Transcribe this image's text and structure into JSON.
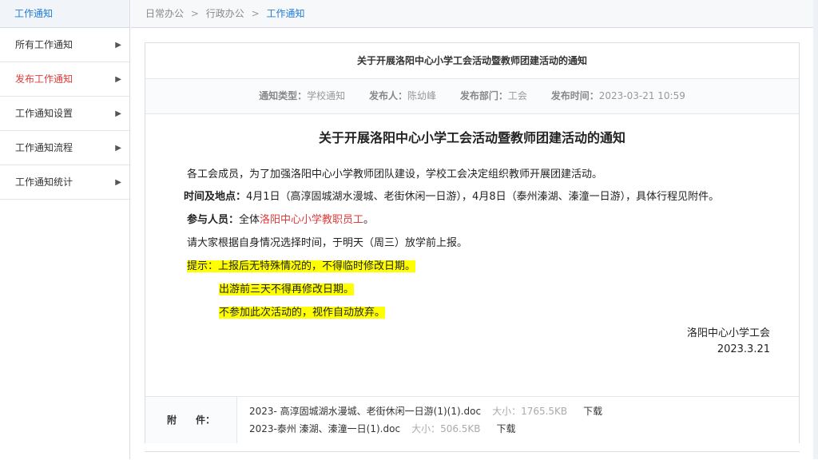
{
  "sidebar": {
    "header": "工作通知",
    "items": [
      {
        "label": "所有工作通知",
        "active": false
      },
      {
        "label": "发布工作通知",
        "active": true
      },
      {
        "label": "工作通知设置",
        "active": false
      },
      {
        "label": "工作通知流程",
        "active": false
      },
      {
        "label": "工作通知统计",
        "active": false
      }
    ],
    "arrow_glyph": "▶"
  },
  "breadcrumb": {
    "items": [
      "日常办公",
      "行政办公"
    ],
    "current": "工作通知",
    "separator": ">"
  },
  "notice": {
    "panel_title": "关于开展洛阳中心小学工会活动暨教师团建活动的通知",
    "meta": {
      "type_label": "通知类型：",
      "type_value": "学校通知",
      "publisher_label": "发布人：",
      "publisher_value": "陈幼峰",
      "dept_label": "发布部门：",
      "dept_value": "工会",
      "time_label": "发布时间：",
      "time_value": "2023-03-21 10:59"
    },
    "doc_title": "关于开展洛阳中心小学工会活动暨教师团建活动的通知",
    "p1": "各工会成员，为了加强洛阳中心小学教师团队建设，学校工会决定组织教师开展团建活动。",
    "p2_label": "时间及地点：",
    "p2_text": "4月1日（高淳固城湖水漫城、老街休闲一日游），4月8日（泰州溱湖、溱潼一日游），具体行程见附件。",
    "p3_label": "参与人员：",
    "p3_prefix": "全体",
    "p3_red": "洛阳中心小学教职员工",
    "p3_suffix": "。",
    "p4": "请大家根据自身情况选择时间，于明天（周三）放学前上报。",
    "tip1": "提示：上报后无特殊情况的，不得临时修改日期。",
    "tip2": "出游前三天不得再修改日期。",
    "tip3": "不参加此次活动的，视作自动放弃。",
    "sign_org": "洛阳中心小学工会",
    "sign_date": "2023.3.21"
  },
  "attachments": {
    "label": "附　　件：",
    "files": [
      {
        "name": "2023- 高淳固城湖水漫城、老街休闲一日游(1)(1).doc",
        "size": "大小：1765.5KB",
        "download": "下载"
      },
      {
        "name": "2023-泰州 溱湖、溱潼一日(1).doc",
        "size": "大小：506.5KB",
        "download": "下载"
      }
    ]
  },
  "colors": {
    "accent": "#1f7bd8",
    "active_red": "#e03a3a",
    "highlight": "#ffff00"
  }
}
